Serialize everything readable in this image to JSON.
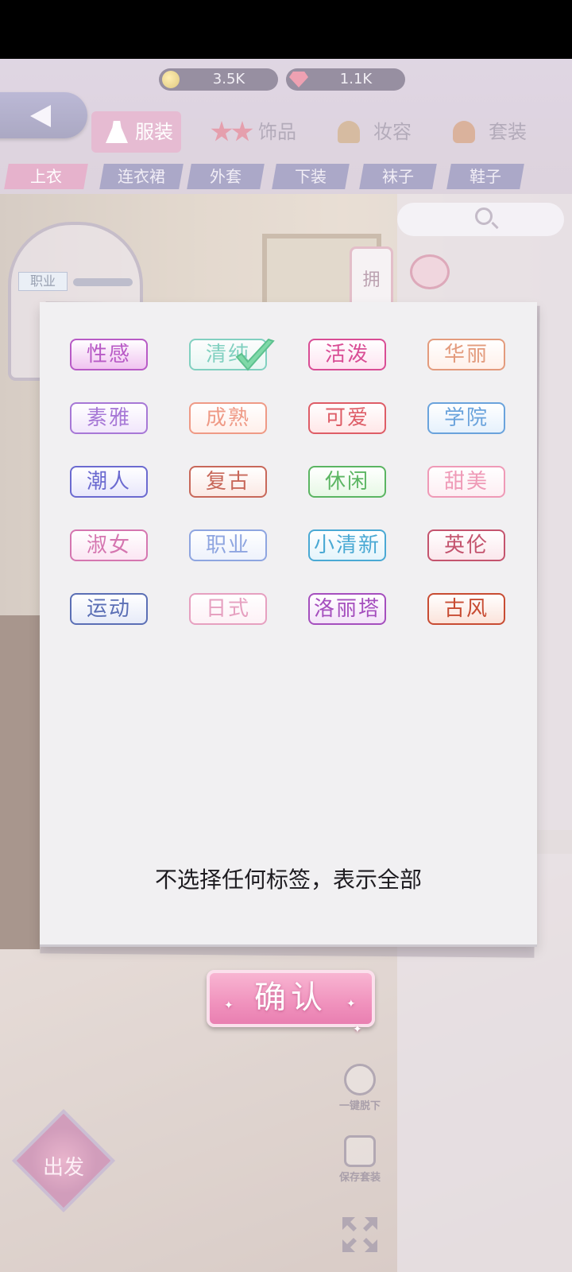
{
  "currency": {
    "gold": "3.5K",
    "gems": "1.1K"
  },
  "category_tabs": [
    {
      "label": "服装",
      "icon": "dress-icon",
      "active": true
    },
    {
      "label": "饰品",
      "icon": "star-icon",
      "active": false
    },
    {
      "label": "妆容",
      "icon": "makeup-icon",
      "active": false
    },
    {
      "label": "套装",
      "icon": "suit-icon",
      "active": false
    }
  ],
  "sub_tabs": [
    {
      "label": "上衣",
      "active": true
    },
    {
      "label": "连衣裙"
    },
    {
      "label": "外套"
    },
    {
      "label": "下装"
    },
    {
      "label": "袜子"
    },
    {
      "label": "鞋子"
    }
  ],
  "left_panel": {
    "tag": "职业"
  },
  "right_card": {
    "label": "拥"
  },
  "tools": {
    "undress_label": "一键脱下",
    "save_label": "保存套装"
  },
  "go_button": "出发",
  "tags_dialog": {
    "tags": [
      {
        "label": "性感",
        "selected": false,
        "color": "#b85ac6",
        "bg": "#f0c3f0"
      },
      {
        "label": "清纯",
        "selected": true,
        "color": "#6ecbb8",
        "bg": "#e8f8f4"
      },
      {
        "label": "活泼",
        "selected": false,
        "color": "#d94d95",
        "bg": "#fde4f1"
      },
      {
        "label": "华丽",
        "selected": false,
        "color": "#e39b7d",
        "bg": "#fff0ea"
      },
      {
        "label": "素雅",
        "selected": false,
        "color": "#a778d6",
        "bg": "#f1e6fb"
      },
      {
        "label": "成熟",
        "selected": false,
        "color": "#ef9a86",
        "bg": "#fff0eb"
      },
      {
        "label": "可爱",
        "selected": false,
        "color": "#de5d67",
        "bg": "#ffe7e8"
      },
      {
        "label": "学院",
        "selected": false,
        "color": "#6aa3dc",
        "bg": "#e6f1fc"
      },
      {
        "label": "潮人",
        "selected": false,
        "color": "#6b6ad0",
        "bg": "#e8e7fb"
      },
      {
        "label": "复古",
        "selected": false,
        "color": "#c8685a",
        "bg": "#fbe9e4"
      },
      {
        "label": "休闲",
        "selected": false,
        "color": "#5bb562",
        "bg": "#e7f8e5"
      },
      {
        "label": "甜美",
        "selected": false,
        "color": "#ef9ab7",
        "bg": "#fdeef3"
      },
      {
        "label": "淑女",
        "selected": false,
        "color": "#d576b0",
        "bg": "#fbe6f3"
      },
      {
        "label": "职业",
        "selected": false,
        "color": "#8ea5e0",
        "bg": "#eef2fc"
      },
      {
        "label": "小清新",
        "selected": false,
        "color": "#4aa9d4",
        "bg": "#e4f4fb"
      },
      {
        "label": "英伦",
        "selected": false,
        "color": "#c4546e",
        "bg": "#fbe7ec"
      },
      {
        "label": "运动",
        "selected": false,
        "color": "#5b6fb5",
        "bg": "#e7ebf8"
      },
      {
        "label": "日式",
        "selected": false,
        "color": "#e6a0c0",
        "bg": "#fdf1f6"
      },
      {
        "label": "洛丽塔",
        "selected": false,
        "color": "#a54fbe",
        "bg": "#f3e3f8"
      },
      {
        "label": "古风",
        "selected": false,
        "color": "#c84c33",
        "bg": "#fbe3db"
      }
    ],
    "hint": "不选择任何标签，表示全部",
    "confirm_label": "确认"
  }
}
